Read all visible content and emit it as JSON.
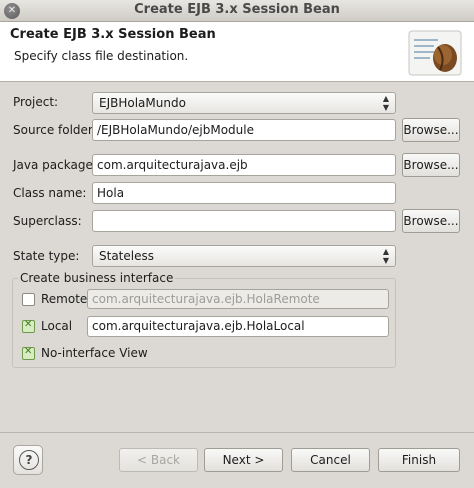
{
  "window": {
    "title": "Create EJB 3.x Session Bean",
    "close_glyph": "✕"
  },
  "banner": {
    "heading": "Create EJB 3.x Session Bean",
    "subtitle": "Specify class file destination.",
    "icon": "coffee-bean-wizard-icon"
  },
  "form": {
    "project_label": "Project:",
    "project_value": "EJBHolaMundo",
    "source_folder_label": "Source folder:",
    "source_folder_value": "/EJBHolaMundo/ejbModule",
    "java_package_label": "Java package:",
    "java_package_value": "com.arquitecturajava.ejb",
    "class_name_label": "Class name:",
    "class_name_value": "Hola",
    "superclass_label": "Superclass:",
    "superclass_value": "",
    "state_type_label": "State type:",
    "state_type_value": "Stateless",
    "browse_label": "Browse..."
  },
  "business_interface": {
    "title": "Create business interface",
    "remote_label": "Remote",
    "remote_checked": false,
    "remote_value": "com.arquitecturajava.ejb.HolaRemote",
    "local_label": "Local",
    "local_checked": true,
    "local_value": "com.arquitecturajava.ejb.HolaLocal",
    "no_interface_label": "No-interface View",
    "no_interface_checked": true
  },
  "buttons": {
    "help": "?",
    "back": "< Back",
    "next": "Next >",
    "cancel": "Cancel",
    "finish": "Finish"
  },
  "colors": {
    "window_bg": "#dcd9d4",
    "banner_bg": "#ffffff",
    "check_green": "#3f7a1c"
  }
}
